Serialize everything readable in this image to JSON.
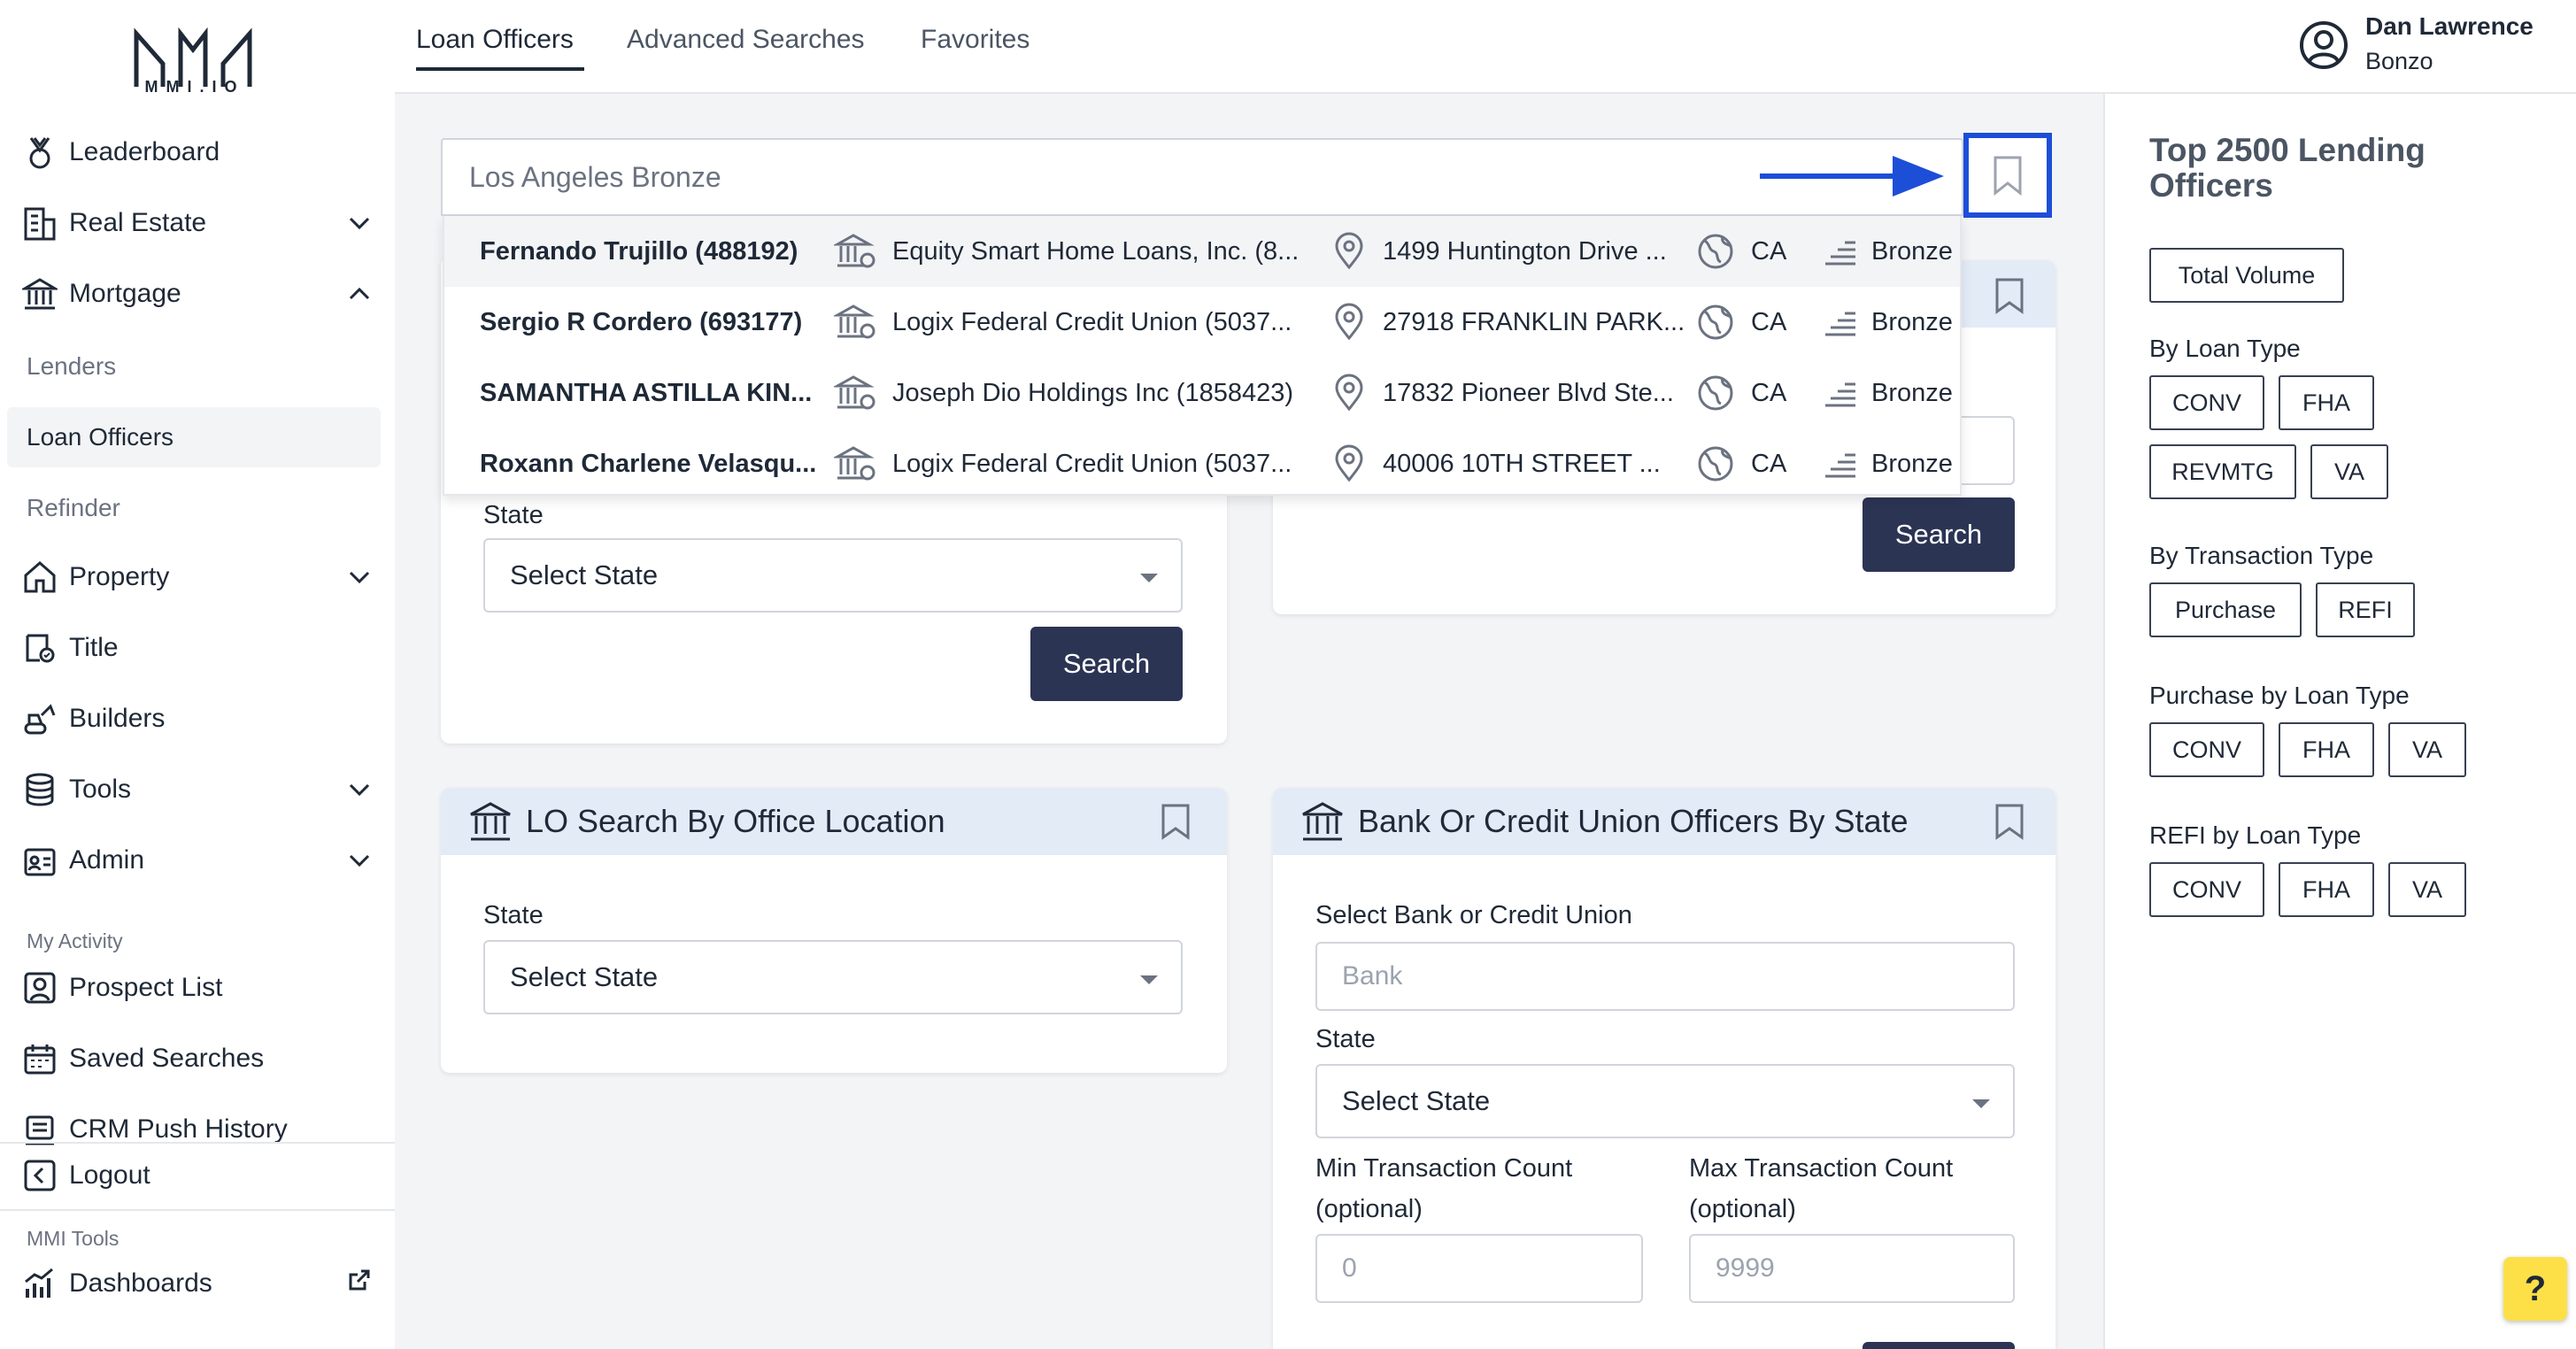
{
  "brand": {
    "logo_text": "MMI.IO"
  },
  "topbar": {
    "tabs": [
      {
        "label": "Loan Officers"
      },
      {
        "label": "Advanced Searches"
      },
      {
        "label": "Favorites"
      }
    ],
    "user": {
      "name": "Dan Lawrence",
      "org": "Bonzo"
    }
  },
  "sidebar": {
    "items": {
      "leaderboard": "Leaderboard",
      "real_estate": "Real Estate",
      "mortgage": "Mortgage",
      "lenders": "Lenders",
      "loan_officers": "Loan Officers",
      "refinder": "Refinder",
      "property": "Property",
      "title": "Title",
      "builders": "Builders",
      "tools": "Tools",
      "admin": "Admin"
    },
    "my_activity_label": "My Activity",
    "activity": {
      "prospect_list": "Prospect List",
      "saved_searches": "Saved Searches",
      "crm_push_history": "CRM Push History"
    },
    "logout": "Logout",
    "mmi_tools_label": "MMI Tools",
    "dashboards": "Dashboards"
  },
  "search": {
    "value": "Los Angeles Bronze",
    "results": [
      {
        "name": "Fernando Trujillo (488192)",
        "company": "Equity Smart Home Loans, Inc. (8...",
        "address": "1499 Huntington Drive ...",
        "state": "CA",
        "tier": "Bronze"
      },
      {
        "name": "Sergio R Cordero (693177)",
        "company": "Logix Federal Credit Union (5037...",
        "address": "27918 FRANKLIN PARK...",
        "state": "CA",
        "tier": "Bronze"
      },
      {
        "name": "SAMANTHA ASTILLA KIN...",
        "company": "Joseph Dio Holdings Inc (1858423)",
        "address": "17832 Pioneer Blvd Ste...",
        "state": "CA",
        "tier": "Bronze"
      },
      {
        "name": "Roxann Charlene Velasqu...",
        "company": "Logix Federal Credit Union (5037...",
        "address": "40006 10TH STREET ...",
        "state": "CA",
        "tier": "Bronze"
      }
    ]
  },
  "card_a": {
    "state_label": "State",
    "state_value": "Select State",
    "search_label": "Search"
  },
  "card_b": {
    "search_label": "Search"
  },
  "card_office": {
    "title": "LO Search By Office Location",
    "state_label": "State",
    "state_value": "Select State"
  },
  "card_bank": {
    "title": "Bank Or Credit Union Officers By State",
    "bank_label": "Select Bank or Credit Union",
    "bank_placeholder": "Bank",
    "state_label": "State",
    "state_value": "Select State",
    "min_label_1": "Min Transaction Count",
    "min_label_2": "(optional)",
    "max_label_1": "Max Transaction Count",
    "max_label_2": "(optional)",
    "min_placeholder": "0",
    "max_placeholder": "9999"
  },
  "right_panel": {
    "title": "Top 2500 Lending Officers",
    "total_volume": "Total Volume",
    "by_loan_type": {
      "label": "By Loan Type",
      "buttons": [
        "CONV",
        "FHA",
        "REVMTG",
        "VA"
      ]
    },
    "by_transaction_type": {
      "label": "By Transaction Type",
      "buttons": [
        "Purchase",
        "REFI"
      ]
    },
    "purchase_by_loan_type": {
      "label": "Purchase by Loan Type",
      "buttons": [
        "CONV",
        "FHA",
        "VA"
      ]
    },
    "refi_by_loan_type": {
      "label": "REFI by Loan Type",
      "buttons": [
        "CONV",
        "FHA",
        "VA"
      ]
    }
  },
  "help": {
    "label": "?"
  }
}
